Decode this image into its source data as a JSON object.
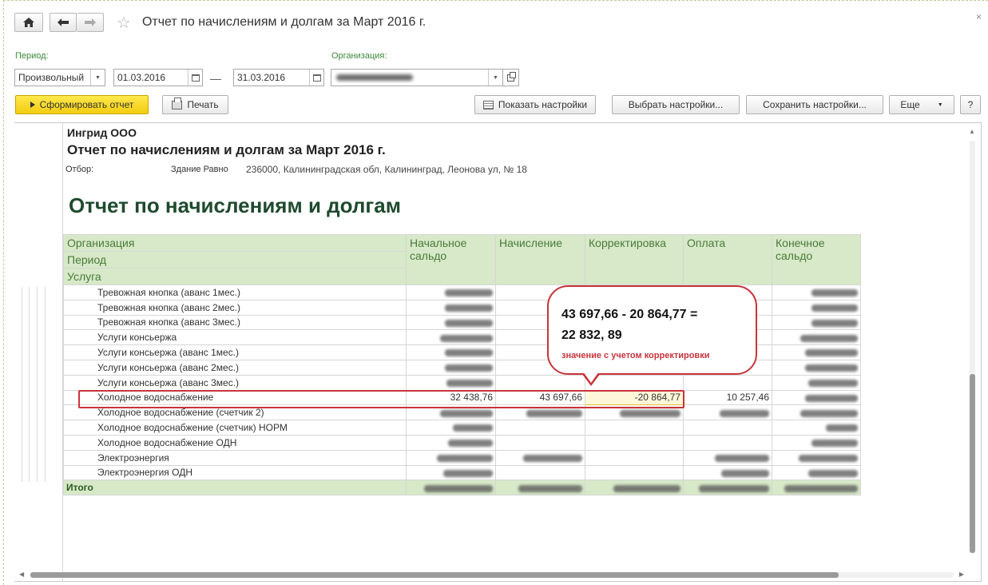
{
  "window": {
    "title": "Отчет по начислениям и долгам  за Март 2016 г.",
    "close_glyph": "×"
  },
  "params": {
    "period_label": "Период:",
    "period_type": "Произвольный",
    "date_from": "01.03.2016",
    "date_sep": "—",
    "date_to": "31.03.2016",
    "org_label": "Организация:"
  },
  "toolbar": {
    "generate": "Сформировать отчет",
    "print": "Печать",
    "show_settings": "Показать настройки",
    "choose_settings": "Выбрать настройки...",
    "save_settings": "Сохранить настройки...",
    "more": "Еще",
    "help": "?"
  },
  "report": {
    "company": "Ингрид ООО",
    "title": "Отчет по начислениям и долгам  за Март 2016 г.",
    "selection_label": "Отбор:",
    "selection_key": "Здание Равно",
    "selection_value": "236000, Калининградская обл, Калининград, Леонова ул, № 18",
    "big_title": "Отчет по начислениям и долгам",
    "headers": {
      "organization": "Организация",
      "period": "Период",
      "service": "Услуга",
      "opening": "Начальное сальдо",
      "accrual": "Начисление",
      "adjustment": "Корректировка",
      "payment": "Оплата",
      "closing": "Конечное сальдо"
    },
    "rows": [
      {
        "service": "Тревожная кнопка (аванс 1мес.)",
        "opening": "",
        "accrual": "",
        "adjustment": "",
        "payment": "",
        "closing": ""
      },
      {
        "service": "Тревожная кнопка (аванс 2мес.)",
        "opening": "",
        "accrual": "",
        "adjustment": "",
        "payment": "",
        "closing": ""
      },
      {
        "service": "Тревожная кнопка (аванс 3мес.)",
        "opening": "",
        "accrual": "",
        "adjustment": "",
        "payment": "",
        "closing": ""
      },
      {
        "service": "Услуги консьержа",
        "opening": "",
        "accrual": "",
        "adjustment": "",
        "payment": "",
        "closing": ""
      },
      {
        "service": "Услуги консьержа (аванс 1мес.)",
        "opening": "",
        "accrual": "",
        "adjustment": "",
        "payment": "",
        "closing": ""
      },
      {
        "service": "Услуги консьержа (аванс 2мес.)",
        "opening": "",
        "accrual": "",
        "adjustment": "",
        "payment": "",
        "closing": ""
      },
      {
        "service": "Услуги консьержа (аванс 3мес.)",
        "opening": "",
        "accrual": "",
        "adjustment": "",
        "payment": "",
        "closing": ""
      },
      {
        "service": "Холодное водоснабжение",
        "opening": "32 438,76",
        "accrual": "43 697,66",
        "adjustment": "-20 864,77",
        "payment": "10 257,46",
        "closing": ""
      },
      {
        "service": "Холодное водоснабжение (счетчик 2)",
        "opening": "",
        "accrual": "",
        "adjustment": "",
        "payment": "",
        "closing": ""
      },
      {
        "service": "Холодное водоснабжение (счетчик) НОРМ",
        "opening": "",
        "accrual": "",
        "adjustment": "",
        "payment": "",
        "closing": ""
      },
      {
        "service": "Холодное водоснабжение ОДН",
        "opening": "",
        "accrual": "",
        "adjustment": "",
        "payment": "",
        "closing": ""
      },
      {
        "service": "Электроэнергия",
        "opening": "",
        "accrual": "",
        "adjustment": "",
        "payment": "",
        "closing": ""
      },
      {
        "service": "Электроэнергия ОДН",
        "opening": "",
        "accrual": "",
        "adjustment": "",
        "payment": "",
        "closing": ""
      }
    ],
    "total_label": "Итого"
  },
  "callout": {
    "line1": "43 697,66 - 20 864,77 =",
    "line2": "22 832, 89",
    "note": "значение с учетом корректировки"
  },
  "colors": {
    "accent_yellow": "#f2cc10",
    "header_green": "#d7e9c8",
    "label_green": "#3a8a3a",
    "highlight_red": "#c8343c"
  }
}
